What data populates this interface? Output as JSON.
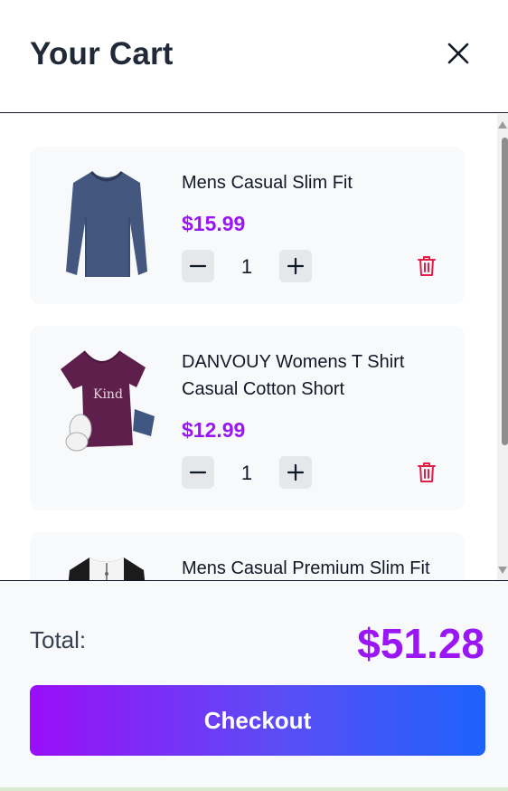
{
  "header": {
    "title": "Your Cart"
  },
  "items": [
    {
      "name": "Mens Casual Slim Fit",
      "price": "$15.99",
      "quantity": "1"
    },
    {
      "name": "DANVOUY Womens T Shirt Casual Cotton Short",
      "price": "$12.99",
      "quantity": "1"
    },
    {
      "name": "Mens Casual Premium Slim Fit"
    }
  ],
  "footer": {
    "total_label": "Total:",
    "total_value": "$51.28",
    "checkout_label": "Checkout"
  },
  "colors": {
    "accent": "#9a16f4",
    "delete": "#e11d48",
    "gradient_start": "#9a0ef7",
    "gradient_end": "#1e62fb"
  },
  "icons": {
    "close": "close-icon",
    "decrease": "minus-icon",
    "increase": "plus-icon",
    "delete": "trash-icon"
  }
}
